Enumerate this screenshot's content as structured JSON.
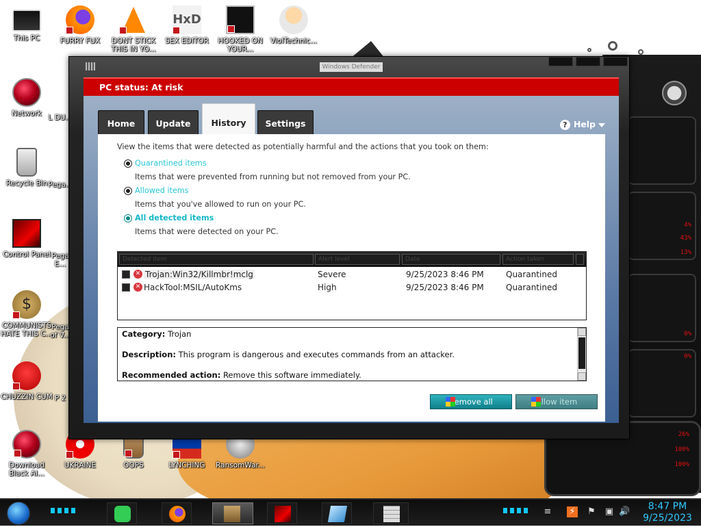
{
  "desktop": {
    "icons": [
      {
        "label": "This PC"
      },
      {
        "label": "Network"
      },
      {
        "label": "Recycle Bin"
      },
      {
        "label": "Control Panel"
      },
      {
        "label": "COMMUNISTS HATE THIS C..."
      },
      {
        "label": "CHUZZIN CUM"
      },
      {
        "label": "Download Black Al..."
      },
      {
        "label": "FURRY FUX"
      },
      {
        "label": "DONT STICK THIS IN YO..."
      },
      {
        "label": "SEX EDITOR"
      },
      {
        "label": "HOOKED ON YOUR..."
      },
      {
        "label": "VioITechnic..."
      },
      {
        "label": "UKRAINE"
      },
      {
        "label": "OOPS"
      },
      {
        "label": "LYNCHING"
      },
      {
        "label": "RansomWar..."
      },
      {
        "label": "L DU..."
      },
      {
        "label": "Pega..."
      },
      {
        "label": "Pega E..."
      },
      {
        "label": "Pega of V..."
      },
      {
        "label": "P 2"
      }
    ]
  },
  "window": {
    "title": "Windows Defender",
    "status": "PC status: At risk",
    "tabs": [
      {
        "label": "Home"
      },
      {
        "label": "Update"
      },
      {
        "label": "History"
      },
      {
        "label": "Settings"
      }
    ],
    "active_tab": "History",
    "help_label": "Help",
    "intro": "View the items that were detected as potentially harmful and the actions that you took on them:",
    "options": [
      {
        "label": "Quarantined items",
        "desc": "Items that were prevented from running but not removed from your PC.",
        "selected": false
      },
      {
        "label": "Allowed items",
        "desc": "Items that you've allowed to run on your PC.",
        "selected": false
      },
      {
        "label": "All detected items",
        "desc": "Items that were detected on your PC.",
        "selected": true
      }
    ],
    "grid": {
      "headers": [
        "Detected item",
        "Alert level",
        "Date",
        "Action taken"
      ],
      "rows": [
        {
          "name": "Trojan:Win32/Killmbr!mclg",
          "level": "Severe",
          "date": "9/25/2023 8:46 PM",
          "action": "Quarantined"
        },
        {
          "name": "HackTool:MSIL/AutoKms",
          "level": "High",
          "date": "9/25/2023 8:46 PM",
          "action": "Quarantined"
        }
      ]
    },
    "details": {
      "category_label": "Category:",
      "category": "Trojan",
      "description_label": "Description:",
      "description": "This program is dangerous and executes commands from an attacker.",
      "action_label": "Recommended action:",
      "action": "Remove this software immediately."
    },
    "buttons": {
      "remove_all": "Remove all",
      "allow_item": "Allow item"
    }
  },
  "gadget": {
    "percents": [
      "4%",
      "43%",
      "13%",
      "0%",
      "0%",
      "26%",
      "100%",
      "100%"
    ]
  },
  "taskbar": {
    "time": "8:47 PM",
    "date": "9/25/2023"
  },
  "colors": {
    "status_red": "#cc0000",
    "link_teal": "#27c6d6",
    "button_teal": "#1a9aa6",
    "clock_blue": "#2fc9ff"
  }
}
